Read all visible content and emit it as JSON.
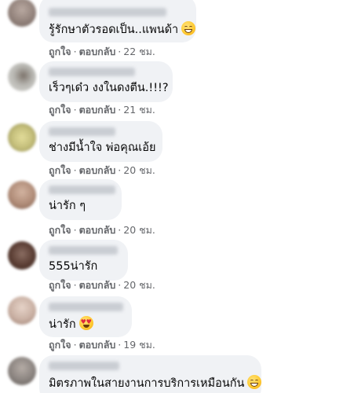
{
  "comments": [
    {
      "text": "รู้รักษาตัวรอดเป็น..แพนด้า",
      "emoji": "grin",
      "like_label": "ถูกใจ",
      "reply_label": "ตอบกลับ",
      "time": "22 ชม.",
      "avatar_color": "#8f7f78"
    },
    {
      "text": "เร็วๆเด๋ว งงในดงตีน.!!!?",
      "emoji": "",
      "like_label": "ถูกใจ",
      "reply_label": "ตอบกลับ",
      "time": "21 ชม.",
      "avatar_color": "#b9b8b3"
    },
    {
      "text": "ช่างมีน้ำใจ พ่อคุณเอ้ย",
      "emoji": "",
      "like_label": "ถูกใจ",
      "reply_label": "ตอบกลับ",
      "time": "20 ชม.",
      "avatar_color": "#c6c07c"
    },
    {
      "text": "น่ารัก ๆ",
      "emoji": "",
      "like_label": "ถูกใจ",
      "reply_label": "ตอบกลับ",
      "time": "20 ชม.",
      "avatar_color": "#b08c78"
    },
    {
      "text": "555น่ารัก",
      "emoji": "",
      "like_label": "ถูกใจ",
      "reply_label": "ตอบกลับ",
      "time": "20 ชม.",
      "avatar_color": "#5a3d33"
    },
    {
      "text": "น่ารัก",
      "emoji": "heart-eyes",
      "like_label": "ถูกใจ",
      "reply_label": "ตอบกลับ",
      "time": "19 ชม.",
      "avatar_color": "#c9b0a3"
    },
    {
      "text": "มิตรภาพในสายงานการบริการเหมือนกัน",
      "emoji": "grin",
      "like_label": "",
      "reply_label": "",
      "time": "",
      "avatar_color": "#8b8480"
    }
  ],
  "separator": "·"
}
